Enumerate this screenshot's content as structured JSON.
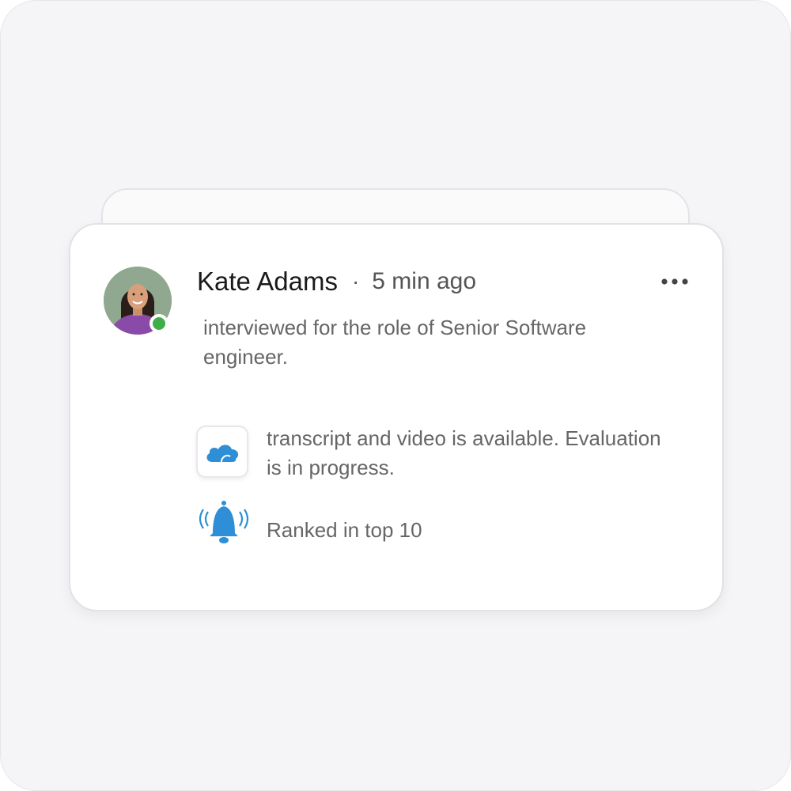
{
  "notification": {
    "name": "Kate Adams",
    "separator": "·",
    "time": "5 min ago",
    "description": "interviewed for the role of Senior Software engineer.",
    "transcript_text": "transcript and video is available. Evaluation is in progress.",
    "ranked_text": "Ranked in top 10"
  },
  "icons": {
    "avatar": "avatar-photo",
    "status": "online-status-dot",
    "more": "more-horizontal-icon",
    "cloud": "cloud-icon",
    "bell": "ringing-bell-icon"
  },
  "colors": {
    "background": "#f5f5f7",
    "card": "#ffffff",
    "online": "#3fae49",
    "accent_blue": "#2e8fd6",
    "text_primary": "#1a1a1a",
    "text_secondary": "#666666"
  }
}
